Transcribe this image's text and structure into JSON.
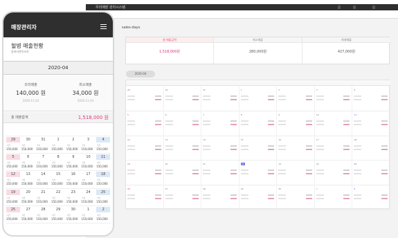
{
  "desktop": {
    "brand": "우리매장 관리시스템",
    "top_buttons": [
      "",
      "",
      ""
    ],
    "menu": [
      "",
      "",
      "",
      ""
    ],
    "page_title": "sales-days",
    "summary": [
      {
        "title": "총 매출금액",
        "value": "1,518,000원",
        "accent": true
      },
      {
        "title": "최소매출",
        "value": "280,000원",
        "accent": false
      },
      {
        "title": "최대매출",
        "value": "427,000원",
        "accent": false
      }
    ],
    "month_pill": "2020-04",
    "weekdays": [
      "",
      "",
      "",
      "",
      "",
      "",
      ""
    ],
    "weeks": [
      [
        "29",
        "30",
        "31",
        "1",
        "2",
        "3",
        "4"
      ],
      [
        "5",
        "6",
        "7",
        "8",
        "9",
        "10",
        "11"
      ],
      [
        "12",
        "13",
        "14",
        "15",
        "16",
        "17",
        "18"
      ],
      [
        "19",
        "20",
        "21",
        "22",
        "23",
        "24",
        "25"
      ],
      [
        "26",
        "27",
        "28",
        "29",
        "30",
        "1",
        "2"
      ]
    ]
  },
  "mobile": {
    "header_title": "매장관리자",
    "store_name": "혈병 매출현황",
    "store_sub": "장바라관리코카",
    "month": "2020-04",
    "stats": [
      {
        "label": "조미매출",
        "value": "140,000 원",
        "date": "2020-11-24"
      },
      {
        "label": "최소매출",
        "value": "34,000 원",
        "date": "2020-11-24"
      }
    ],
    "total_label": "총 매출합계",
    "total_value": "1,518,000 원",
    "weekdays": [
      "",
      "",
      "",
      "",
      "",
      "",
      ""
    ],
    "weeks": [
      {
        "days": [
          "29",
          "30",
          "31",
          "1",
          "2",
          "3",
          "4"
        ],
        "counts": [
          "3건",
          "3건",
          "3건",
          "3건",
          "3건",
          "3건",
          "3건"
        ],
        "amounts": [
          "150,000",
          "150,000",
          "150,000",
          "150,000",
          "150,000",
          "150,000",
          "150,000"
        ]
      },
      {
        "days": [
          "5",
          "6",
          "7",
          "8",
          "9",
          "10",
          "11"
        ],
        "counts": [
          "3건",
          "3건",
          "3건",
          "3건",
          "3건",
          "3건",
          "3건"
        ],
        "amounts": [
          "150,000",
          "150,000",
          "150,000",
          "150,000",
          "150,000",
          "150,000",
          "150,000"
        ]
      },
      {
        "days": [
          "12",
          "13",
          "14",
          "15",
          "16",
          "17",
          "18"
        ],
        "counts": [
          "3건",
          "3건",
          "3건",
          "3건",
          "3건",
          "3건",
          "3건"
        ],
        "amounts": [
          "150,000",
          "150,000",
          "150,000",
          "150,000",
          "150,000",
          "150,000",
          "150,000"
        ]
      },
      {
        "days": [
          "19",
          "20",
          "21",
          "22",
          "23",
          "24",
          "25"
        ],
        "counts": [
          "3건",
          "3건",
          "3건",
          "3건",
          "3건",
          "3건",
          "3건"
        ],
        "amounts": [
          "150,000",
          "150,000",
          "150,000",
          "150,000",
          "150,000",
          "150,000",
          "150,000"
        ]
      },
      {
        "days": [
          "25",
          "27",
          "28",
          "29",
          "30",
          "1",
          "2"
        ],
        "counts": [
          "3건",
          "3건",
          "3건",
          "3건",
          "3건",
          "3건",
          "3건"
        ],
        "amounts": [
          "150,000",
          "150,000",
          "150,000",
          "150,000",
          "150,000",
          "150,000",
          "150,000"
        ]
      }
    ]
  }
}
